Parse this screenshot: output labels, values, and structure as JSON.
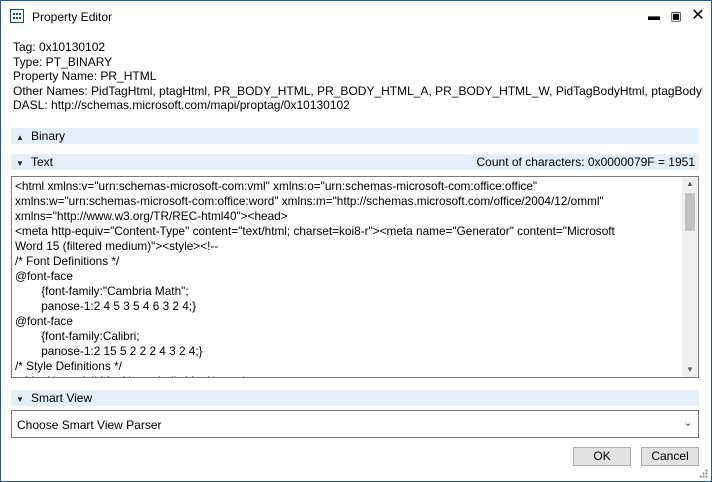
{
  "window": {
    "title": "Property Editor",
    "minimize_icon": "minimize-icon",
    "maximize_icon": "maximize-icon",
    "close_icon": "close-icon"
  },
  "property": {
    "tag": "Tag: 0x10130102",
    "type": "Type: PT_BINARY",
    "name": "Property Name: PR_HTML",
    "other_names": "Other Names: PidTagHtml, ptagHtml, PR_BODY_HTML, PR_BODY_HTML_A, PR_BODY_HTML_W, PidTagBodyHtml, ptagBodyHtml",
    "dasl": "DASL: http://schemas.microsoft.com/mapi/proptag/0x10130102"
  },
  "sections": {
    "binary": {
      "label": "Binary",
      "state": "collapsed"
    },
    "text": {
      "label": "Text",
      "state": "expanded",
      "count": "Count of characters: 0x0000079F = 1951",
      "content": "<html xmlns:v=\"urn:schemas-microsoft-com:vml\" xmlns:o=\"urn:schemas-microsoft-com:office:office\"\nxmlns:w=\"urn:schemas-microsoft-com:office:word\" xmlns:m=\"http://schemas.microsoft.com/office/2004/12/omml\"\nxmlns=\"http://www.w3.org/TR/REC-html40\"><head>\n<meta http-equiv=\"Content-Type\" content=\"text/html; charset=koi8-r\"><meta name=\"Generator\" content=\"Microsoft\nWord 15 (filtered medium)\"><style><!--\n/* Font Definitions */\n@font-face\n\t{font-family:\"Cambria Math\";\n\tpanose-1:2 4 5 3 5 4 6 3 2 4;}\n@font-face\n\t{font-family:Calibri;\n\tpanose-1:2 15 5 2 2 2 4 3 2 4;}\n/* Style Definitions */\np.MsoNormal, li.MsoNormal, div.MsoNormal"
    },
    "smart_view": {
      "label": "Smart View",
      "state": "expanded",
      "parser_value": "Choose Smart View Parser"
    }
  },
  "buttons": {
    "ok": "OK",
    "cancel": "Cancel"
  },
  "colors": {
    "section_header_bg": "#e4eef9",
    "window_border": "#2b579a"
  }
}
